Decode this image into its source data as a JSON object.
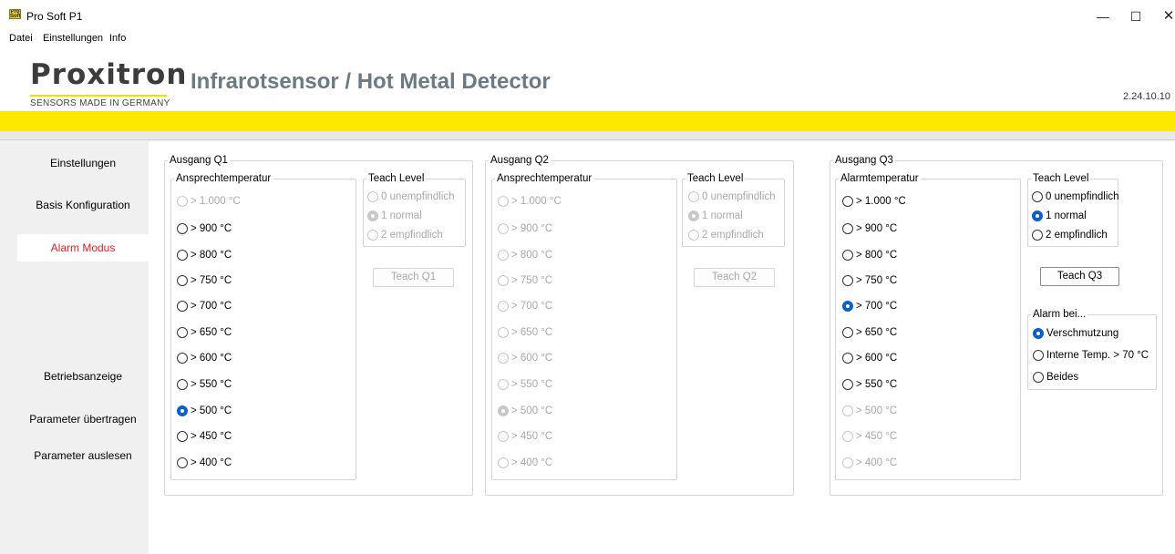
{
  "window": {
    "title": "Pro Soft P1",
    "icon": "app-icon",
    "icon_text": "Pro Soft"
  },
  "menu": {
    "items": [
      "Datei",
      "Einstellungen",
      "Info"
    ]
  },
  "header": {
    "logo_text": "Proxitron",
    "logo_tagline": "SENSORS MADE IN GERMANY",
    "title": "Infrarotsensor / Hot Metal Detector",
    "version": "2.24.10.10"
  },
  "colors": {
    "accent_yellow": "#fde800",
    "active_nav": "#e02020",
    "radio_blue": "#0a5fc9",
    "title_grey": "#6b7a85"
  },
  "sidebar": {
    "items": [
      {
        "label": "Einstellungen"
      },
      {
        "label": "Basis Konfiguration"
      },
      {
        "label": "Alarm Modus",
        "active": true
      },
      {
        "label": "Betriebsanzeige"
      },
      {
        "label": "Parameter übertragen"
      },
      {
        "label": "Parameter auslesen"
      }
    ]
  },
  "outputs": [
    {
      "title": "Ausgang Q1",
      "temp_group": "Ansprechtemperatur",
      "temps": [
        "> 1.000 °C",
        "> 900 °C",
        "> 800 °C",
        "> 750 °C",
        "> 700 °C",
        "> 650 °C",
        "> 600 °C",
        "> 550 °C",
        "> 500 °C",
        "> 450 °C",
        "> 400 °C"
      ],
      "selected_temp": "> 500 °C",
      "teach_group": "Teach Level",
      "teach_levels": [
        "0 unempfindlich",
        "1 normal",
        "2 empfindlich"
      ],
      "selected_teach": "1 normal",
      "teach_button": "Teach Q1"
    },
    {
      "title": "Ausgang Q2",
      "temp_group": "Ansprechtemperatur",
      "temps": [
        "> 1.000 °C",
        "> 900 °C",
        "> 800 °C",
        "> 750 °C",
        "> 700 °C",
        "> 650 °C",
        "> 600 °C",
        "> 550 °C",
        "> 500 °C",
        "> 450 °C",
        "> 400 °C"
      ],
      "selected_temp": "> 500 °C",
      "teach_group": "Teach Level",
      "teach_levels": [
        "0 unempfindlich",
        "1 normal",
        "2 empfindlich"
      ],
      "selected_teach": "1 normal",
      "teach_button": "Teach Q2"
    },
    {
      "title": "Ausgang Q3",
      "temp_group": "Alarmtemperatur",
      "temps": [
        "> 1.000 °C",
        "> 900 °C",
        "> 800 °C",
        "> 750 °C",
        "> 700 °C",
        "> 650 °C",
        "> 600 °C",
        "> 550 °C",
        "> 500 °C",
        "> 450 °C",
        "> 400 °C"
      ],
      "selected_temp": "> 700 °C",
      "teach_group": "Teach Level",
      "teach_levels": [
        "0 unempfindlich",
        "1 normal",
        "2 empfindlich"
      ],
      "selected_teach": "1 normal",
      "teach_button": "Teach Q3",
      "alarm_group": "Alarm bei...",
      "alarm_options": [
        "Verschmutzung",
        "Interne Temp. > 70 °C",
        "Beides"
      ],
      "selected_alarm": "Verschmutzung"
    }
  ]
}
